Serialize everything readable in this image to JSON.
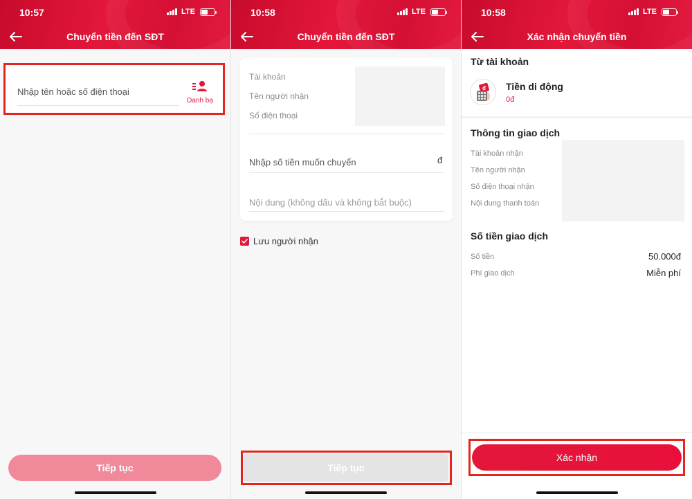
{
  "status_bar": {
    "screen1_time": "10:57",
    "screen2_time": "10:58",
    "screen3_time": "10:58",
    "network": "LTE"
  },
  "screen1": {
    "title": "Chuyển tiền đến SĐT",
    "search_placeholder": "Nhập tên hoặc số điện thoại",
    "contacts_label": "Danh bạ",
    "contacts_icon": "contacts-list-icon",
    "continue_label": "Tiếp tục"
  },
  "screen2": {
    "title": "Chuyển tiền đến SĐT",
    "account_label": "Tài khoản",
    "recipient_name_label": "Tên người nhận",
    "phone_label": "Số điện thoại",
    "amount_placeholder": "Nhập số tiền muốn chuyển",
    "currency_symbol": "đ",
    "note_placeholder": "Nội dung (không dấu và không bắt buộc)",
    "save_recipient_label": "Lưu người nhận",
    "save_recipient_checked": true,
    "continue_label": "Tiếp tục"
  },
  "screen3": {
    "title": "Xác nhận chuyển tiền",
    "from_account_title": "Từ tài khoản",
    "wallet_name": "Tiền di động",
    "wallet_balance": "0đ",
    "transaction_info_title": "Thông tin giao dịch",
    "receiver_account_label": "Tài khoản nhận",
    "receiver_name_label": "Tên người nhận",
    "receiver_phone_label": "Số điện thoại nhận",
    "payment_note_label": "Nội dung thanh toán",
    "amount_section_title": "Số tiền giao dịch",
    "amount_label": "Số tiền",
    "amount_value": "50.000đ",
    "fee_label": "Phí giao dịch",
    "fee_value": "Miễn phí",
    "confirm_label": "Xác nhận"
  },
  "colors": {
    "brand_red": "#e3173a",
    "highlight_border": "#e3261d",
    "disabled_button_pink": "#f08a9b",
    "disabled_button_gray": "#e4e4e4"
  }
}
